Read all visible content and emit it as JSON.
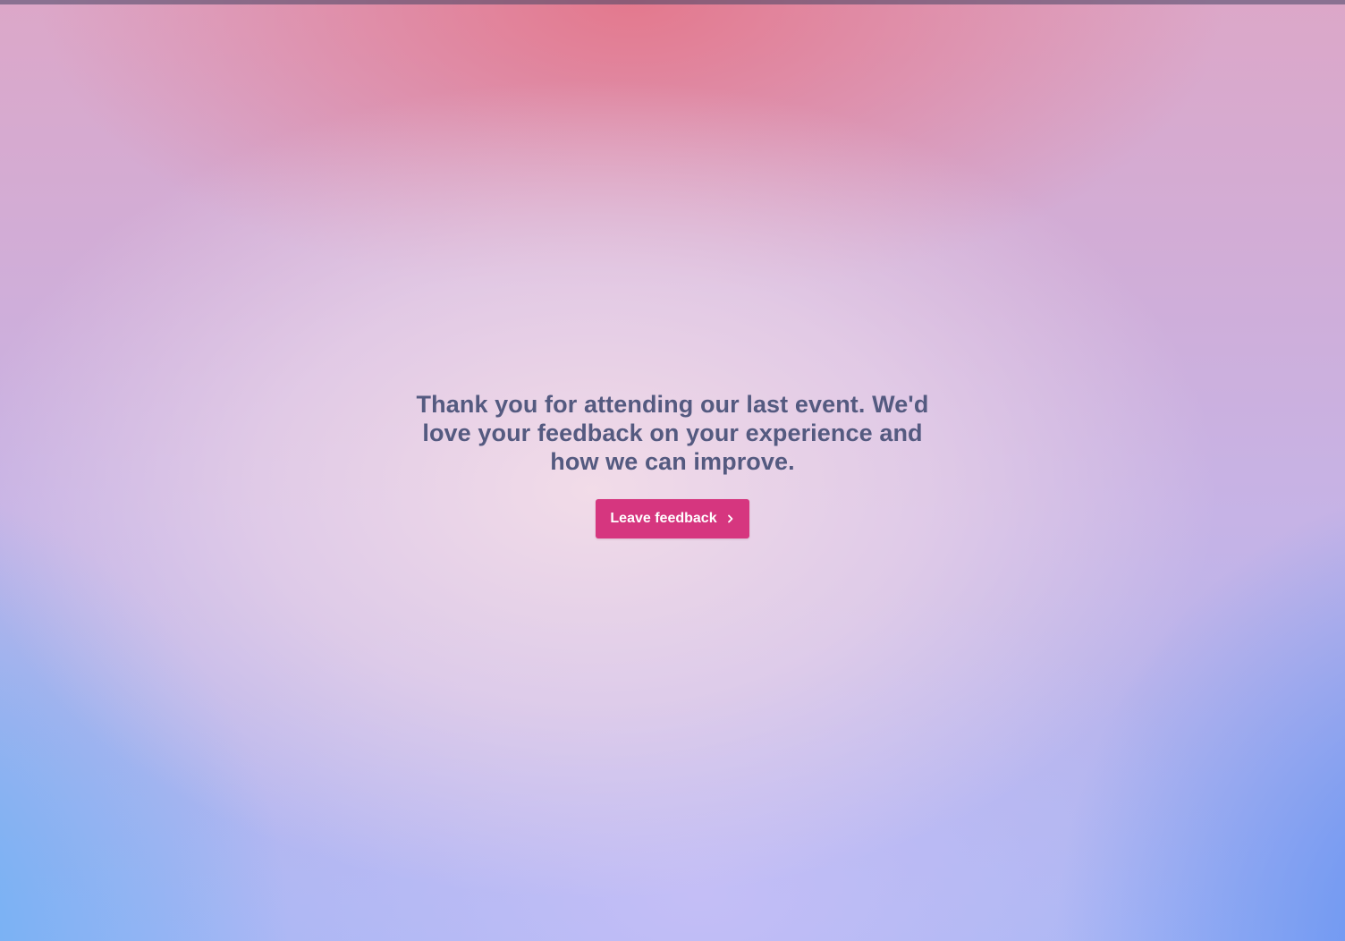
{
  "message": {
    "text": "Thank you for attending our last event. We'd love your feedback on your experience and how we can improve."
  },
  "cta": {
    "label": "Leave feedback",
    "icon": "chevron-right-icon",
    "color": "#d6367f"
  },
  "colors": {
    "text": "#545a80",
    "gradient_top": "#e4768a",
    "gradient_bottom_left": "#66b0f4",
    "gradient_bottom_right": "#5c8ef2"
  }
}
